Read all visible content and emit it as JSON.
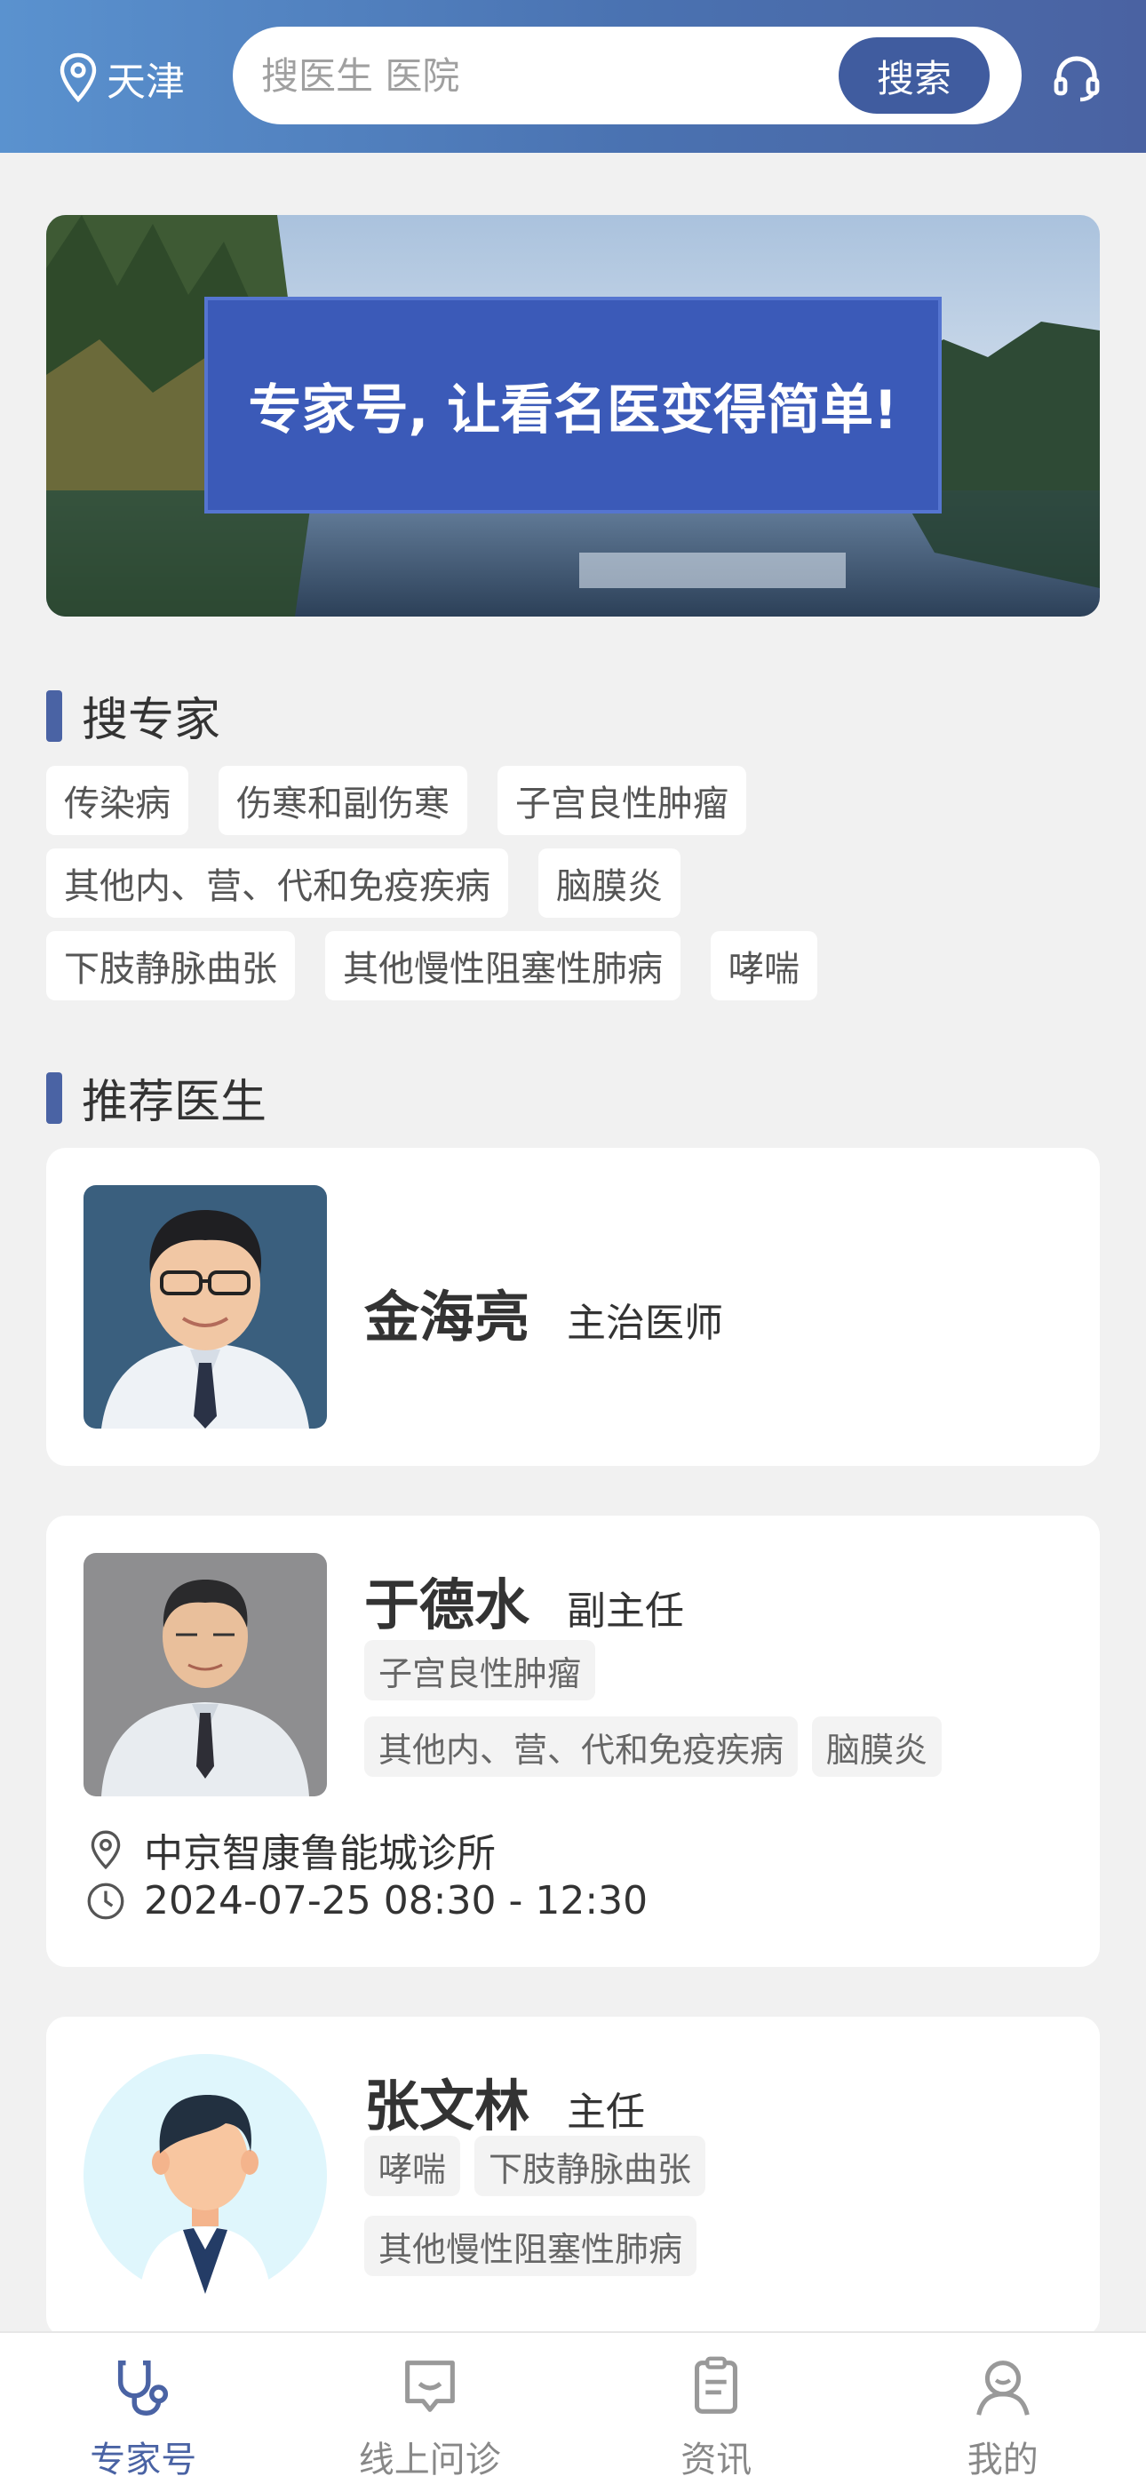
{
  "header": {
    "city": "天津",
    "search_placeholder": "搜医生 医院",
    "search_button": "搜索"
  },
  "banner": {
    "text": "专家号, 让看名医变得简单!"
  },
  "search_experts": {
    "title": "搜专家",
    "tags": [
      [
        "传染病",
        "伤寒和副伤寒",
        "子宫良性肿瘤"
      ],
      [
        "其他内、营、代和免疫疾病",
        "脑膜炎"
      ],
      [
        "下肢静脉曲张",
        "其他慢性阻塞性肺病",
        "哮喘"
      ]
    ]
  },
  "recommended": {
    "title": "推荐医生",
    "doctors": [
      {
        "name": "金海亮",
        "title": "主治医师"
      },
      {
        "name": "于德水",
        "title": "副主任",
        "tags": [
          "子宫良性肿瘤",
          "其他内、营、代和免疫疾病",
          "脑膜炎"
        ],
        "hospital": "中京智康鲁能城诊所",
        "time": "2024-07-25 08:30 - 12:30"
      },
      {
        "name": "张文林",
        "title": "主任",
        "tags": [
          "哮喘",
          "下肢静脉曲张",
          "其他慢性阻塞性肺病"
        ]
      }
    ]
  },
  "tabbar": {
    "tabs": [
      "专家号",
      "线上问诊",
      "资讯",
      "我的"
    ],
    "active": 0
  },
  "colors": {
    "primary": "#4a63a4",
    "header_start": "#5a92cf",
    "header_end": "#4a62a2",
    "background": "#f1f1f1"
  }
}
